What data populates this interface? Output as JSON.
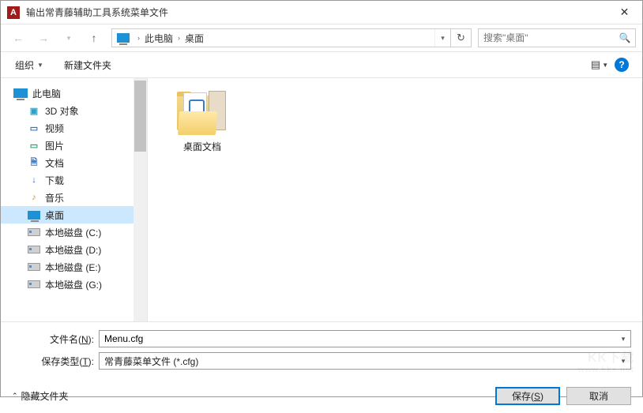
{
  "title": "输出常青藤辅助工具系统菜单文件",
  "breadcrumb": {
    "root": "此电脑",
    "current": "桌面"
  },
  "search": {
    "placeholder": "搜索\"桌面\""
  },
  "toolbar": {
    "organize": "组织",
    "new_folder": "新建文件夹"
  },
  "tree": {
    "root": "此电脑",
    "items": [
      {
        "label": "3D 对象",
        "icon": "3d",
        "color": "#2aa3c9"
      },
      {
        "label": "视频",
        "icon": "video",
        "color": "#3a6fb7"
      },
      {
        "label": "图片",
        "icon": "pictures",
        "color": "#29a36a"
      },
      {
        "label": "文档",
        "icon": "docs",
        "color": "#3a7bc8"
      },
      {
        "label": "下载",
        "icon": "down",
        "color": "#2a6fd0"
      },
      {
        "label": "音乐",
        "icon": "music",
        "color": "#d08a2a"
      },
      {
        "label": "桌面",
        "icon": "desktop",
        "color": "#1e90d4",
        "selected": true
      },
      {
        "label": "本地磁盘 (C:)",
        "icon": "disk"
      },
      {
        "label": "本地磁盘 (D:)",
        "icon": "disk"
      },
      {
        "label": "本地磁盘 (E:)",
        "icon": "disk"
      },
      {
        "label": "本地磁盘 (G:)",
        "icon": "disk"
      }
    ]
  },
  "content": {
    "folder_label": "桌面文档"
  },
  "fields": {
    "filename_label_pre": "文件名(",
    "filename_label_key": "N",
    "filename_label_post": "):",
    "filename_value": "Menu.cfg",
    "filetype_label_pre": "保存类型(",
    "filetype_label_key": "T",
    "filetype_label_post": "):",
    "filetype_value": "常青藤菜单文件 (*.cfg)"
  },
  "footer": {
    "hide_folders": "隐藏文件夹",
    "save_pre": "保存(",
    "save_key": "S",
    "save_post": ")",
    "cancel": "取消"
  },
  "icons": {
    "3d": "▣",
    "video": "▭",
    "pictures": "▭",
    "docs": "🗎",
    "down": "↓",
    "music": "♪"
  }
}
